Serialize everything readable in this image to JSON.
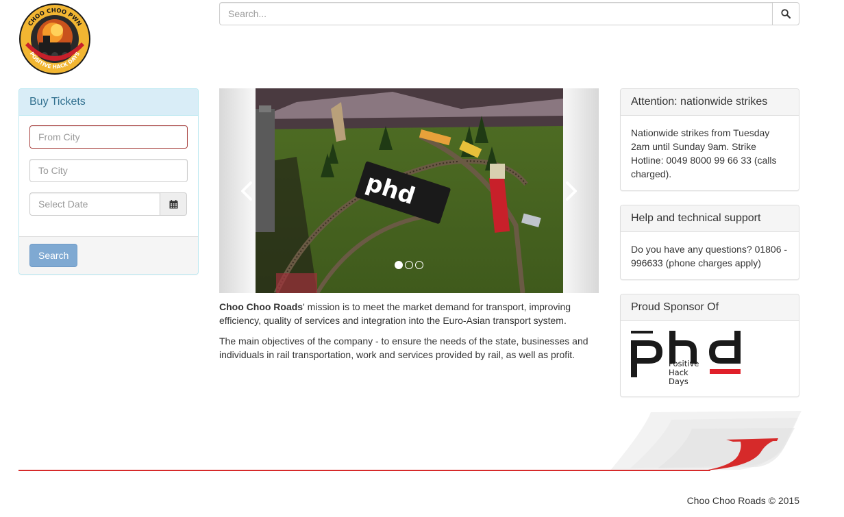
{
  "brand": {
    "logo_top_text": "CHOO CHOO PWN",
    "logo_bottom_text": "POSITIVE HACK DAYS",
    "name": "Choo Choo Roads"
  },
  "search": {
    "placeholder": "Search...",
    "icon": "search-icon"
  },
  "buy_tickets": {
    "title": "Buy Tickets",
    "from_placeholder": "From City",
    "to_placeholder": "To City",
    "date_placeholder": "Select Date",
    "calendar_icon": "calendar-icon",
    "search_label": "Search"
  },
  "carousel": {
    "prev_icon": "chevron-left-icon",
    "next_icon": "chevron-right-icon",
    "slide_count": 3,
    "active_slide": 1
  },
  "mission": {
    "company_name": "Choo Choo Roads",
    "paragraph1_rest": "' mission is to meet the market demand for transport, improving efficiency, quality of services and integration into the Euro-Asian transport system.",
    "paragraph2": "The main objectives of the company - to ensure the needs of the state, businesses and individuals in rail transportation, work and services provided by rail, as well as profit."
  },
  "attention": {
    "title": "Attention: nationwide strikes",
    "body": "Nationwide strikes from Tuesday 2am until Sunday 9am. Strike Hotline: 0049 8000 99 66 33 (calls charged)."
  },
  "support": {
    "title": "Help and technical support",
    "body": "Do you have any questions? 01806 - 996633 (phone charges apply)"
  },
  "sponsor": {
    "title": "Proud Sponsor Of",
    "logo_letters": "phd",
    "logo_line1": "Positive",
    "logo_line2": "Hack",
    "logo_line3": "Days"
  },
  "footer": {
    "copyright": "Choo Choo Roads © 2015"
  },
  "colors": {
    "panel_info_bg": "#d9edf7",
    "panel_info_text": "#31708f",
    "button_primary": "#7fa9d2",
    "accent_red": "#d62a2a",
    "error_border": "#a94442"
  }
}
